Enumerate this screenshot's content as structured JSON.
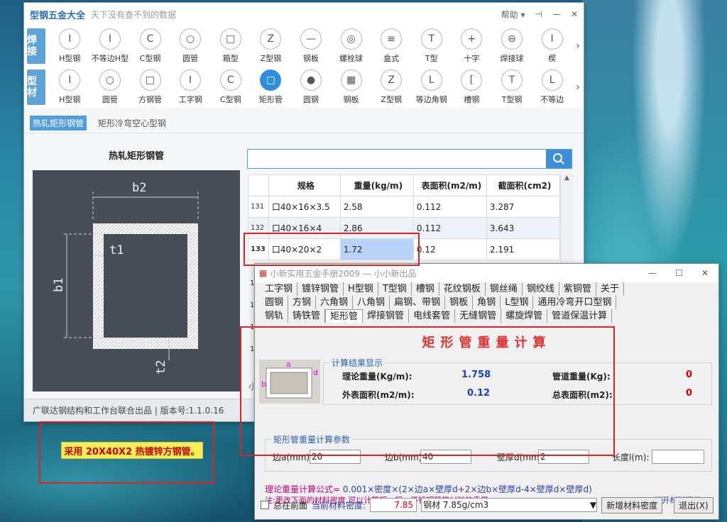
{
  "w1": {
    "title": "型钢五金大全",
    "slogan": "天下没有查不到的数据",
    "help": "帮助",
    "cat1": {
      "label": "焊接",
      "items": [
        "H型钢",
        "不等边H型",
        "C型钢",
        "圆管",
        "箱型",
        "Z型钢",
        "钢板",
        "螺栓球",
        "盒式",
        "T型",
        "十字",
        "焊接球",
        "楔"
      ]
    },
    "cat2": {
      "label": "型材",
      "items": [
        "H型钢",
        "圆管",
        "方钢管",
        "工字钢",
        "C型钢",
        "矩形管",
        "圆钢",
        "钢板",
        "Z型钢",
        "等边角钢",
        "槽钢",
        "T型钢",
        "不等边"
      ]
    },
    "subtabs": [
      "热轧矩形钢管",
      "矩形冷弯空心型钢"
    ],
    "left_title": "热轧矩形钢管",
    "labels": {
      "b2": "b2",
      "t1": "t1",
      "b1": "b1",
      "t2": "t2"
    },
    "table": {
      "headers": [
        "规格",
        "重量(kg/m)",
        "表面积(m2/m)",
        "截面积(cm2)"
      ],
      "rows": [
        [
          "131",
          "口40×16×3.5",
          "2.58",
          "0.112",
          "3.287"
        ],
        [
          "132",
          "口40×16×4",
          "2.86",
          "0.112",
          "3.643"
        ],
        [
          "133",
          "口40×20×2",
          "1.72",
          "0.12",
          "2.191"
        ]
      ],
      "rest_idx": [
        "1",
        "1",
        "1",
        "1"
      ]
    },
    "status": "广联达钢结构和工作台联合出品 | 版本号:1.1.0.16",
    "partial": "小"
  },
  "w2": {
    "title": "小新实用五金手册2009 — 小小新出品",
    "tabs1": [
      "工字钢",
      "镀锌钢管",
      "H型钢",
      "T型钢",
      "槽钢",
      "花纹钢板",
      "钢丝绳",
      "钢绞线",
      "紫铜管",
      "关于"
    ],
    "tabs2": [
      "圆钢",
      "方钢",
      "六角钢",
      "八角钢",
      "扁钢、带钢",
      "钢板",
      "角钢",
      "L型钢",
      "通用冷弯开口型钢"
    ],
    "tabs3": [
      "钢轨",
      "铸铁管",
      "矩形管",
      "焊接钢管",
      "电线套管",
      "无缝钢管",
      "螺旋焊管",
      "管道保温计算"
    ],
    "calc_title": "矩形管重量计算",
    "result_legend": "计算结果显示",
    "result": {
      "theory_label": "理论重量(Kg/m):",
      "theory": "1.758",
      "pipe_label": "管道重量(Kg):",
      "pipe": "0",
      "surface_label": "外表面积(m2/m):",
      "surface": "0.12",
      "total_label": "总表面积(m2):",
      "total": "0"
    },
    "param_legend": "矩形管重量计算参数",
    "params": {
      "a_label": "边a(mm):",
      "a": "20",
      "b_label": "边b(mm):",
      "b": "40",
      "d_label": "壁厚d(mm)",
      "d": "2",
      "l_label": "长度l(m):",
      "l": ""
    },
    "diagram_labels": {
      "a": "a",
      "b": "b",
      "d": "d"
    },
    "formula_key": "理论重量计算公式=",
    "formula": "0.001×密度×(2×边a×壁厚d+2×边b×壁厚d-4×壁厚d×壁厚d)",
    "note": "注:更改下面的材料密度,可以计算铜、铝、不锈钢管等材料的重量。",
    "open_summary": ">>打开材料汇总",
    "front": "总在前面",
    "density_label": "当前材料密度:",
    "density": "7.85",
    "material": "钢材 7.85g/cm3",
    "add_btn": "新增材料密度",
    "exit_btn": "退出(X)"
  },
  "callout": "采用 20X40X2 热镀锌方钢管。"
}
